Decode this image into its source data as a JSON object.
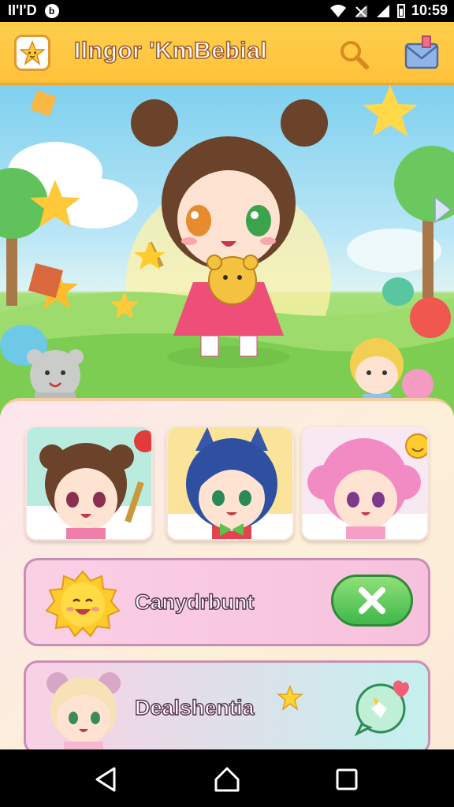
{
  "status_bar": {
    "left_text": "II'I'D",
    "left_icon": "circle-b-icon",
    "time": "10:59",
    "icons": [
      "wifi-icon",
      "signal-off-icon",
      "signal-icon",
      "battery-icon"
    ]
  },
  "header": {
    "title": "Ilngor 'KmBebial",
    "left_button_icon": "star-icon",
    "search_icon": "search-icon",
    "mail_icon": "mailbox-icon"
  },
  "hero": {
    "scene": "chibi-girl-meadow",
    "next_arrow_icon": "chevron-right-icon"
  },
  "character_cards": [
    {
      "name": "brown-haired-chibi",
      "badge_icon": "apple-icon"
    },
    {
      "name": "blue-haired-cat-chibi",
      "badge_icon": ""
    },
    {
      "name": "pink-haired-chibi",
      "badge_icon": "smile-coin-icon"
    }
  ],
  "list_items": [
    {
      "label": "Canydrbunt",
      "avatar_icon": "sun-mascot-icon",
      "action_icon": "close-icon"
    },
    {
      "label": "Dealshentia",
      "avatar_icon": "bear-ear-chibi-icon",
      "action_icon": "chat-bubble-icon"
    }
  ],
  "colors": {
    "header": "#ffc23a",
    "accent_green": "#3fb84a",
    "card_border": "#c98eb4",
    "panel_bg": "#fce6ee"
  },
  "nav": [
    "back-icon",
    "home-icon",
    "recents-icon"
  ]
}
